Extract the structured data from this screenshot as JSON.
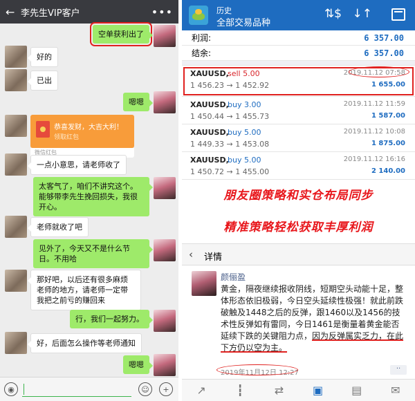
{
  "chat": {
    "title": "李先生VIP客户",
    "back_icon": "arrow-left-icon",
    "more_icon": "more-dots-icon",
    "messages": [
      {
        "side": "right",
        "text": "空单获利出了",
        "highlighted": true
      },
      {
        "side": "left",
        "text": "好的"
      },
      {
        "side": "left",
        "text": "已出"
      },
      {
        "side": "right",
        "text": "嗯嗯"
      },
      {
        "side": "left",
        "type": "red-packet",
        "text": "恭喜发财，大吉大利！",
        "sub": "领取红包",
        "footer": "微信红包"
      },
      {
        "side": "left",
        "text": "一点小意思，请老师收了"
      },
      {
        "side": "right",
        "text": "太客气了，咱们不讲究这个。能够带李先生挽回损失，我很开心。"
      },
      {
        "side": "left",
        "text": "老师就收了吧"
      },
      {
        "side": "right",
        "text": "见外了，今天又不是什么节日。不用哈"
      },
      {
        "side": "left",
        "text": "那好吧，以后还有很多麻烦老师的地方，请老师一定带我把之前亏的赚回来"
      },
      {
        "side": "right",
        "text": "行，我们一起努力。"
      },
      {
        "side": "left",
        "text": "好，后面怎么操作等老师通知"
      },
      {
        "side": "right",
        "text": "嗯嗯"
      }
    ],
    "input_bar": {
      "voice_icon": "voice-icon",
      "emoji_icon": "emoji-icon",
      "plus_icon": "plus-icon"
    }
  },
  "trade": {
    "header": {
      "subtitle": "历史",
      "title": "全部交易品种"
    },
    "summary": [
      {
        "label": "利润:",
        "value": "6 357.00"
      },
      {
        "label": "结余:",
        "value": "6 357.00"
      }
    ],
    "deals": [
      {
        "symbol": "XAUUSD,",
        "type": "sell 5.00",
        "side": "sell",
        "prices": "1 456.23 → 1 452.92",
        "date": "2019.11.12 07:58",
        "profit": "1 655.00",
        "highlighted": true
      },
      {
        "symbol": "XAUUSD,",
        "type": "buy 3.00",
        "side": "buy",
        "prices": "1 450.44 → 1 455.73",
        "date": "2019.11.12 11:59",
        "profit": "1 587.00"
      },
      {
        "symbol": "XAUUSD,",
        "type": "buy 5.00",
        "side": "buy",
        "prices": "1 449.33 → 1 453.08",
        "date": "2019.11.12 10:08",
        "profit": "1 875.00"
      },
      {
        "symbol": "XAUUSD,",
        "type": "buy 5.00",
        "side": "buy",
        "prices": "1 450.72 → 1 455.00",
        "date": "2019.11.12 16:16",
        "profit": "2 140.00"
      }
    ],
    "banner_lines": [
      "朋友圈策略和实仓布局同步",
      "精准策略轻松获取丰厚利润"
    ],
    "detail": {
      "title": "详情"
    },
    "post": {
      "author": "颜俪盈",
      "body_plain": "黄金，隔夜继续报收阴线，短期空头动能十足，整体形态依旧极弱，今日空头延续性极强！就此前跌破触及1448之后的反弹，跟1460以及1456的技术性反弹如有雷同，今日1461是衡量着黄金能否延续下跌的关键阻力点，",
      "body_underlined": "因为反弹属实乏力，在此下方仍以空为主。",
      "time": "2019年11月12日 12:27",
      "more": "··"
    },
    "tabbar": [
      "chart-up-icon",
      "candlestick-icon",
      "trade-icon",
      "history-inbox-icon",
      "news-icon",
      "chat-bubble-icon"
    ],
    "accent": "#1e6cc0",
    "red": "#e0201e"
  }
}
